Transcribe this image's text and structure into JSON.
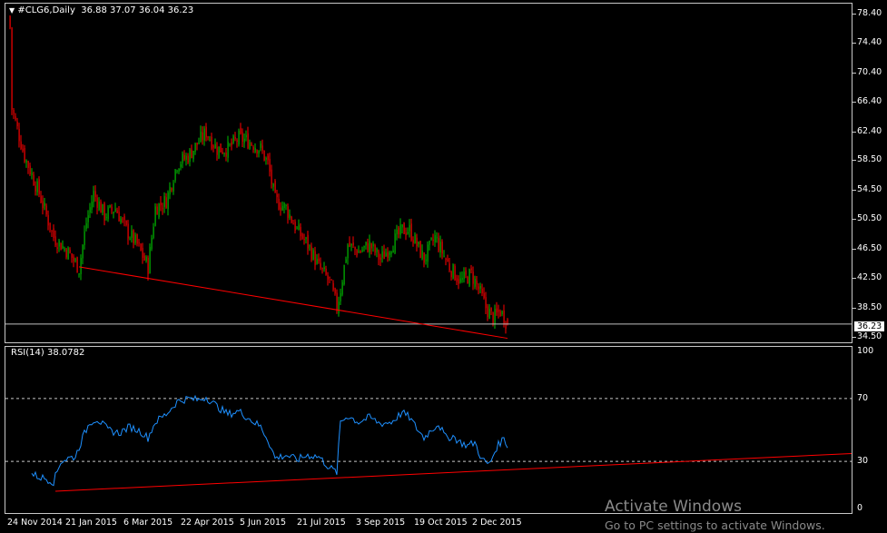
{
  "header": {
    "menu_arrow": "triangle-down-icon",
    "caption": "#CLG6,Daily  36.88 37.07 36.04 36.23"
  },
  "rsi_caption": "RSI(14) 38.0782",
  "price_marker": "36.23",
  "watermark": {
    "title": "Activate Windows",
    "subtitle": "Go to PC settings to activate Windows."
  },
  "colors": {
    "bull": "#00c000",
    "bear": "#ff0000",
    "rsi": "#1e90ff",
    "trendline": "#ff0000",
    "bid_line": "#c0c0c0",
    "level_line": "#c8c8c8"
  },
  "chart_data": [
    {
      "type": "candlestick",
      "symbol": "#CLG6",
      "timeframe": "Daily",
      "last": {
        "open": 36.88,
        "high": 37.07,
        "low": 36.04,
        "close": 36.23
      },
      "y_ticks": [
        "78.40",
        "74.40",
        "70.40",
        "66.40",
        "62.40",
        "58.50",
        "54.50",
        "50.50",
        "46.50",
        "42.50",
        "38.50",
        "34.50"
      ],
      "ylim": [
        34.0,
        79.0
      ],
      "x_ticks": [
        "24 Nov 2014",
        "21 Jan 2015",
        "6 Mar 2015",
        "22 Apr 2015",
        "5 Jun 2015",
        "21 Jul 2015",
        "3 Sep 2015",
        "19 Oct 2015",
        "2 Dec 2015"
      ],
      "anchors": [
        {
          "i": 0,
          "close": 76.5
        },
        {
          "i": 1,
          "close": 65.5
        },
        {
          "i": 8,
          "close": 59
        },
        {
          "i": 16,
          "close": 54
        },
        {
          "i": 24,
          "close": 48
        },
        {
          "i": 32,
          "close": 46
        },
        {
          "i": 38,
          "close": 43.8
        },
        {
          "i": 42,
          "close": 50
        },
        {
          "i": 46,
          "close": 54
        },
        {
          "i": 52,
          "close": 51
        },
        {
          "i": 58,
          "close": 52
        },
        {
          "i": 64,
          "close": 49
        },
        {
          "i": 70,
          "close": 47
        },
        {
          "i": 76,
          "close": 44
        },
        {
          "i": 80,
          "close": 52
        },
        {
          "i": 86,
          "close": 53
        },
        {
          "i": 92,
          "close": 58
        },
        {
          "i": 98,
          "close": 59
        },
        {
          "i": 104,
          "close": 61
        },
        {
          "i": 108,
          "close": 62.3
        },
        {
          "i": 114,
          "close": 60
        },
        {
          "i": 120,
          "close": 60
        },
        {
          "i": 126,
          "close": 61.5
        },
        {
          "i": 132,
          "close": 61
        },
        {
          "i": 138,
          "close": 60
        },
        {
          "i": 142,
          "close": 58
        },
        {
          "i": 146,
          "close": 53
        },
        {
          "i": 152,
          "close": 52
        },
        {
          "i": 158,
          "close": 49
        },
        {
          "i": 164,
          "close": 47
        },
        {
          "i": 170,
          "close": 44
        },
        {
          "i": 176,
          "close": 42
        },
        {
          "i": 180,
          "close": 38.5
        },
        {
          "i": 182,
          "close": 41
        },
        {
          "i": 186,
          "close": 47
        },
        {
          "i": 192,
          "close": 46
        },
        {
          "i": 198,
          "close": 47
        },
        {
          "i": 204,
          "close": 45
        },
        {
          "i": 210,
          "close": 47
        },
        {
          "i": 216,
          "close": 49
        },
        {
          "i": 220,
          "close": 49
        },
        {
          "i": 224,
          "close": 47
        },
        {
          "i": 228,
          "close": 45
        },
        {
          "i": 234,
          "close": 48
        },
        {
          "i": 238,
          "close": 46
        },
        {
          "i": 242,
          "close": 44
        },
        {
          "i": 248,
          "close": 42
        },
        {
          "i": 254,
          "close": 43
        },
        {
          "i": 258,
          "close": 41
        },
        {
          "i": 262,
          "close": 38.5
        },
        {
          "i": 266,
          "close": 37
        },
        {
          "i": 270,
          "close": 38
        },
        {
          "i": 274,
          "close": 36.23
        }
      ],
      "trendline": {
        "x1_date": "21 Jan 2015",
        "y1": 44.0,
        "y2_note": "to last bar",
        "y2": 34.3
      }
    },
    {
      "type": "line",
      "indicator": "RSI(14)",
      "last_value": 38.0782,
      "y_ticks": [
        "100",
        "70",
        "30",
        "0"
      ],
      "levels": [
        70,
        30
      ],
      "ylim": [
        0,
        100
      ],
      "anchors": [
        {
          "i": 12,
          "v": 22
        },
        {
          "i": 16,
          "v": 20
        },
        {
          "i": 20,
          "v": 19
        },
        {
          "i": 24,
          "v": 17
        },
        {
          "i": 28,
          "v": 30
        },
        {
          "i": 32,
          "v": 32
        },
        {
          "i": 36,
          "v": 33
        },
        {
          "i": 40,
          "v": 45
        },
        {
          "i": 44,
          "v": 55
        },
        {
          "i": 48,
          "v": 57
        },
        {
          "i": 54,
          "v": 50
        },
        {
          "i": 60,
          "v": 48
        },
        {
          "i": 66,
          "v": 52
        },
        {
          "i": 72,
          "v": 49
        },
        {
          "i": 76,
          "v": 45
        },
        {
          "i": 80,
          "v": 55
        },
        {
          "i": 86,
          "v": 60
        },
        {
          "i": 92,
          "v": 68
        },
        {
          "i": 98,
          "v": 70
        },
        {
          "i": 104,
          "v": 69
        },
        {
          "i": 108,
          "v": 71
        },
        {
          "i": 114,
          "v": 65
        },
        {
          "i": 120,
          "v": 60
        },
        {
          "i": 126,
          "v": 62
        },
        {
          "i": 132,
          "v": 57
        },
        {
          "i": 138,
          "v": 52
        },
        {
          "i": 142,
          "v": 44
        },
        {
          "i": 146,
          "v": 32
        },
        {
          "i": 152,
          "v": 34
        },
        {
          "i": 158,
          "v": 31
        },
        {
          "i": 164,
          "v": 34
        },
        {
          "i": 170,
          "v": 33
        },
        {
          "i": 176,
          "v": 26
        },
        {
          "i": 180,
          "v": 23
        },
        {
          "i": 182,
          "v": 55
        },
        {
          "i": 186,
          "v": 59
        },
        {
          "i": 192,
          "v": 55
        },
        {
          "i": 198,
          "v": 58
        },
        {
          "i": 204,
          "v": 54
        },
        {
          "i": 210,
          "v": 55
        },
        {
          "i": 216,
          "v": 61
        },
        {
          "i": 220,
          "v": 58
        },
        {
          "i": 224,
          "v": 51
        },
        {
          "i": 228,
          "v": 45
        },
        {
          "i": 232,
          "v": 50
        },
        {
          "i": 236,
          "v": 54
        },
        {
          "i": 240,
          "v": 45
        },
        {
          "i": 244,
          "v": 46
        },
        {
          "i": 248,
          "v": 42
        },
        {
          "i": 252,
          "v": 40
        },
        {
          "i": 256,
          "v": 42
        },
        {
          "i": 260,
          "v": 31
        },
        {
          "i": 264,
          "v": 28
        },
        {
          "i": 268,
          "v": 39
        },
        {
          "i": 272,
          "v": 45
        },
        {
          "i": 274,
          "v": 40
        }
      ],
      "trendline": {
        "y1": 11,
        "y2_note": "extends past last bar to right edge",
        "y2": 35
      }
    }
  ]
}
